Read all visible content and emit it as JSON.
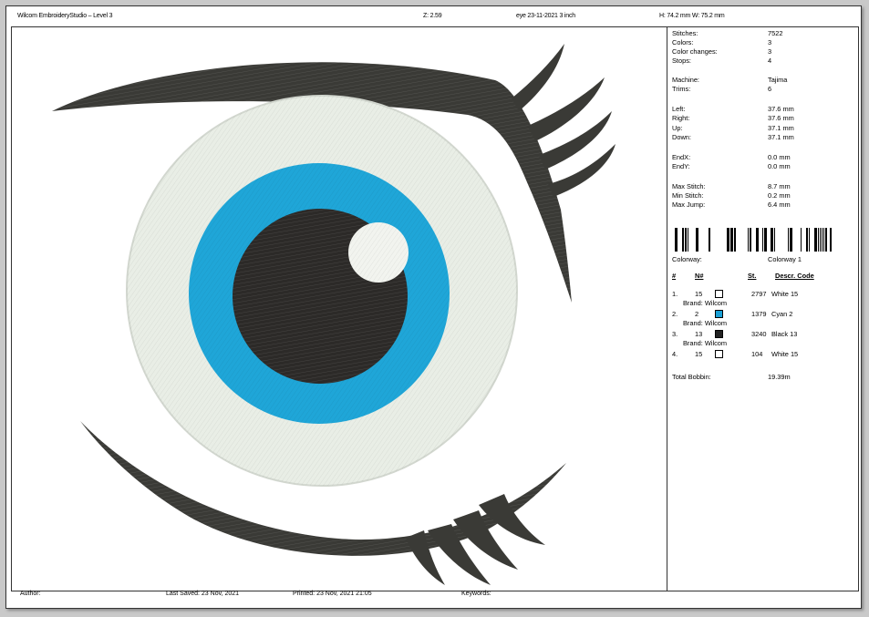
{
  "header": {
    "app": "Wilcom EmbroideryStudio – Level 3",
    "zoom": "Z: 2.59",
    "design": "eye 23-11-2021 3 inch",
    "size": "H: 74.2 mm   W: 75.2 mm"
  },
  "stats": [
    {
      "label": "Stitches:",
      "value": "7522"
    },
    {
      "label": "Colors:",
      "value": "3"
    },
    {
      "label": "Color changes:",
      "value": "3"
    },
    {
      "label": "Stops:",
      "value": "4"
    },
    {
      "label": "Machine:",
      "value": "Tajima"
    },
    {
      "label": "Trims:",
      "value": "6"
    },
    {
      "label": "Left:",
      "value": "37.6 mm"
    },
    {
      "label": "Right:",
      "value": "37.6 mm"
    },
    {
      "label": "Up:",
      "value": "37.1 mm"
    },
    {
      "label": "Down:",
      "value": "37.1 mm"
    },
    {
      "label": "EndX:",
      "value": "0.0 mm"
    },
    {
      "label": "EndY:",
      "value": "0.0 mm"
    },
    {
      "label": "Max Stitch:",
      "value": "8.7 mm"
    },
    {
      "label": "Min Stitch:",
      "value": "0.2 mm"
    },
    {
      "label": "Max Jump:",
      "value": "6.4 mm"
    }
  ],
  "colorway": {
    "label": "Colorway:",
    "value": "Colorway 1"
  },
  "color_table": {
    "headers": {
      "idx": "#",
      "n": "N#",
      "st": "St.",
      "desc": "Descr.  Code"
    },
    "rows": [
      {
        "idx": "1.",
        "n": "15",
        "color": "#ffffff",
        "st": "2797",
        "desc": "White 15",
        "brand": "Brand: Wilcom"
      },
      {
        "idx": "2.",
        "n": "2",
        "color": "#1aa0d6",
        "st": "1379",
        "desc": "Cyan 2",
        "brand": "Brand: Wilcom"
      },
      {
        "idx": "3.",
        "n": "13",
        "color": "#222222",
        "st": "3240",
        "desc": "Black 13",
        "brand": "Brand: Wilcom"
      },
      {
        "idx": "4.",
        "n": "15",
        "color": "#ffffff",
        "st": "104",
        "desc": "White 15",
        "brand": ""
      }
    ],
    "bobbin_label": "Total Bobbin:",
    "bobbin_value": "19.39m"
  },
  "footer": {
    "author": "Author:",
    "last_saved": "Last Saved: 23 Nov, 2021",
    "printed": "Printed: 23 Nov, 2021 21:05",
    "keywords": "Keywords:"
  },
  "colors": {
    "sclera": "#e9eee6",
    "iris": "#1fa6d8",
    "pupil": "#2c2a28",
    "lash": "#3a3a36"
  }
}
